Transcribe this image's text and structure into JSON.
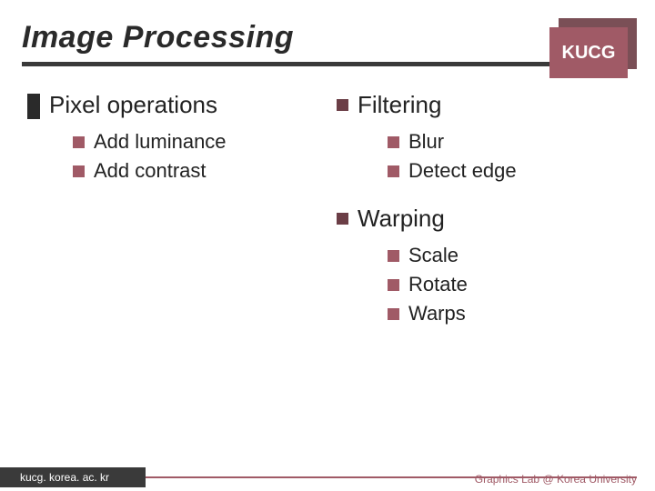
{
  "header": {
    "title": "Image Processing",
    "logo": "KUCG"
  },
  "left": {
    "section": "Pixel operations",
    "items": [
      "Add luminance",
      "Add contrast"
    ]
  },
  "right": {
    "blocks": [
      {
        "section": "Filtering",
        "items": [
          "Blur",
          "Detect edge"
        ]
      },
      {
        "section": "Warping",
        "items": [
          "Scale",
          "Rotate",
          "Warps"
        ]
      }
    ]
  },
  "footer": {
    "left": "kucg. korea. ac. kr",
    "right": "Graphics Lab @ Korea University"
  }
}
